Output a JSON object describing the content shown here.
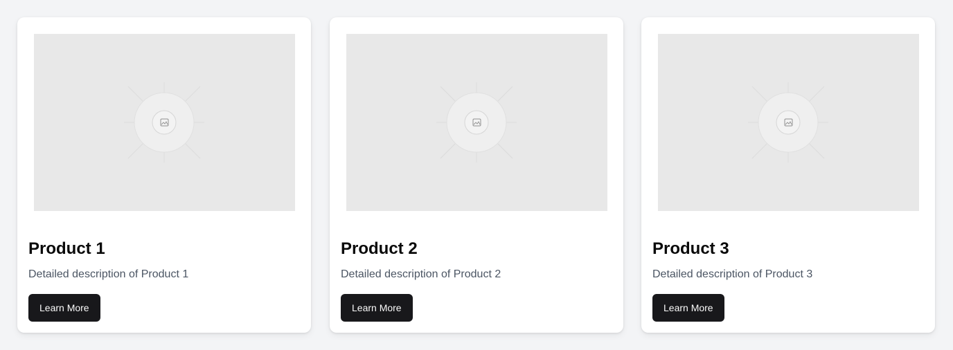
{
  "products": [
    {
      "title": "Product 1",
      "description": "Detailed description of Product 1",
      "button_label": "Learn More",
      "image_icon": "image-placeholder-icon"
    },
    {
      "title": "Product 2",
      "description": "Detailed description of Product 2",
      "button_label": "Learn More",
      "image_icon": "image-placeholder-icon"
    },
    {
      "title": "Product 3",
      "description": "Detailed description of Product 3",
      "button_label": "Learn More",
      "image_icon": "image-placeholder-icon"
    }
  ],
  "colors": {
    "page_background": "#f3f4f6",
    "card_background": "#ffffff",
    "image_placeholder": "#e8e8e8",
    "button_background": "#18181b",
    "button_text": "#fafafa",
    "title_text": "#0a0a0a",
    "description_text": "#4b5563"
  }
}
